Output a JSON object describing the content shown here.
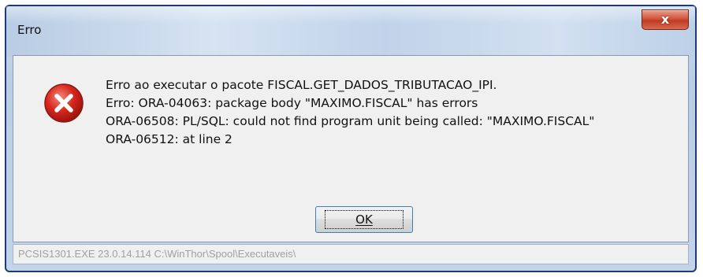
{
  "window": {
    "title": "Erro",
    "close_label": "x"
  },
  "dialog": {
    "icon": "error-icon",
    "message_lines": [
      "Erro ao executar o pacote FISCAL.GET_DADOS_TRIBUTACAO_IPI.",
      "Erro: ORA-04063: package body \"MAXIMO.FISCAL\" has errors",
      "ORA-06508: PL/SQL: could not find program unit being called: \"MAXIMO.FISCAL\"",
      "ORA-06512: at line 2"
    ],
    "ok_label": "OK"
  },
  "status_bar": {
    "text": "PCSIS1301.EXE 23.0.14.114 C:\\WinThor\\Spool\\Executaveis\\"
  },
  "colors": {
    "error_red": "#d8261e",
    "close_button": "#c9462e",
    "ok_border": "#3c7fb1"
  }
}
